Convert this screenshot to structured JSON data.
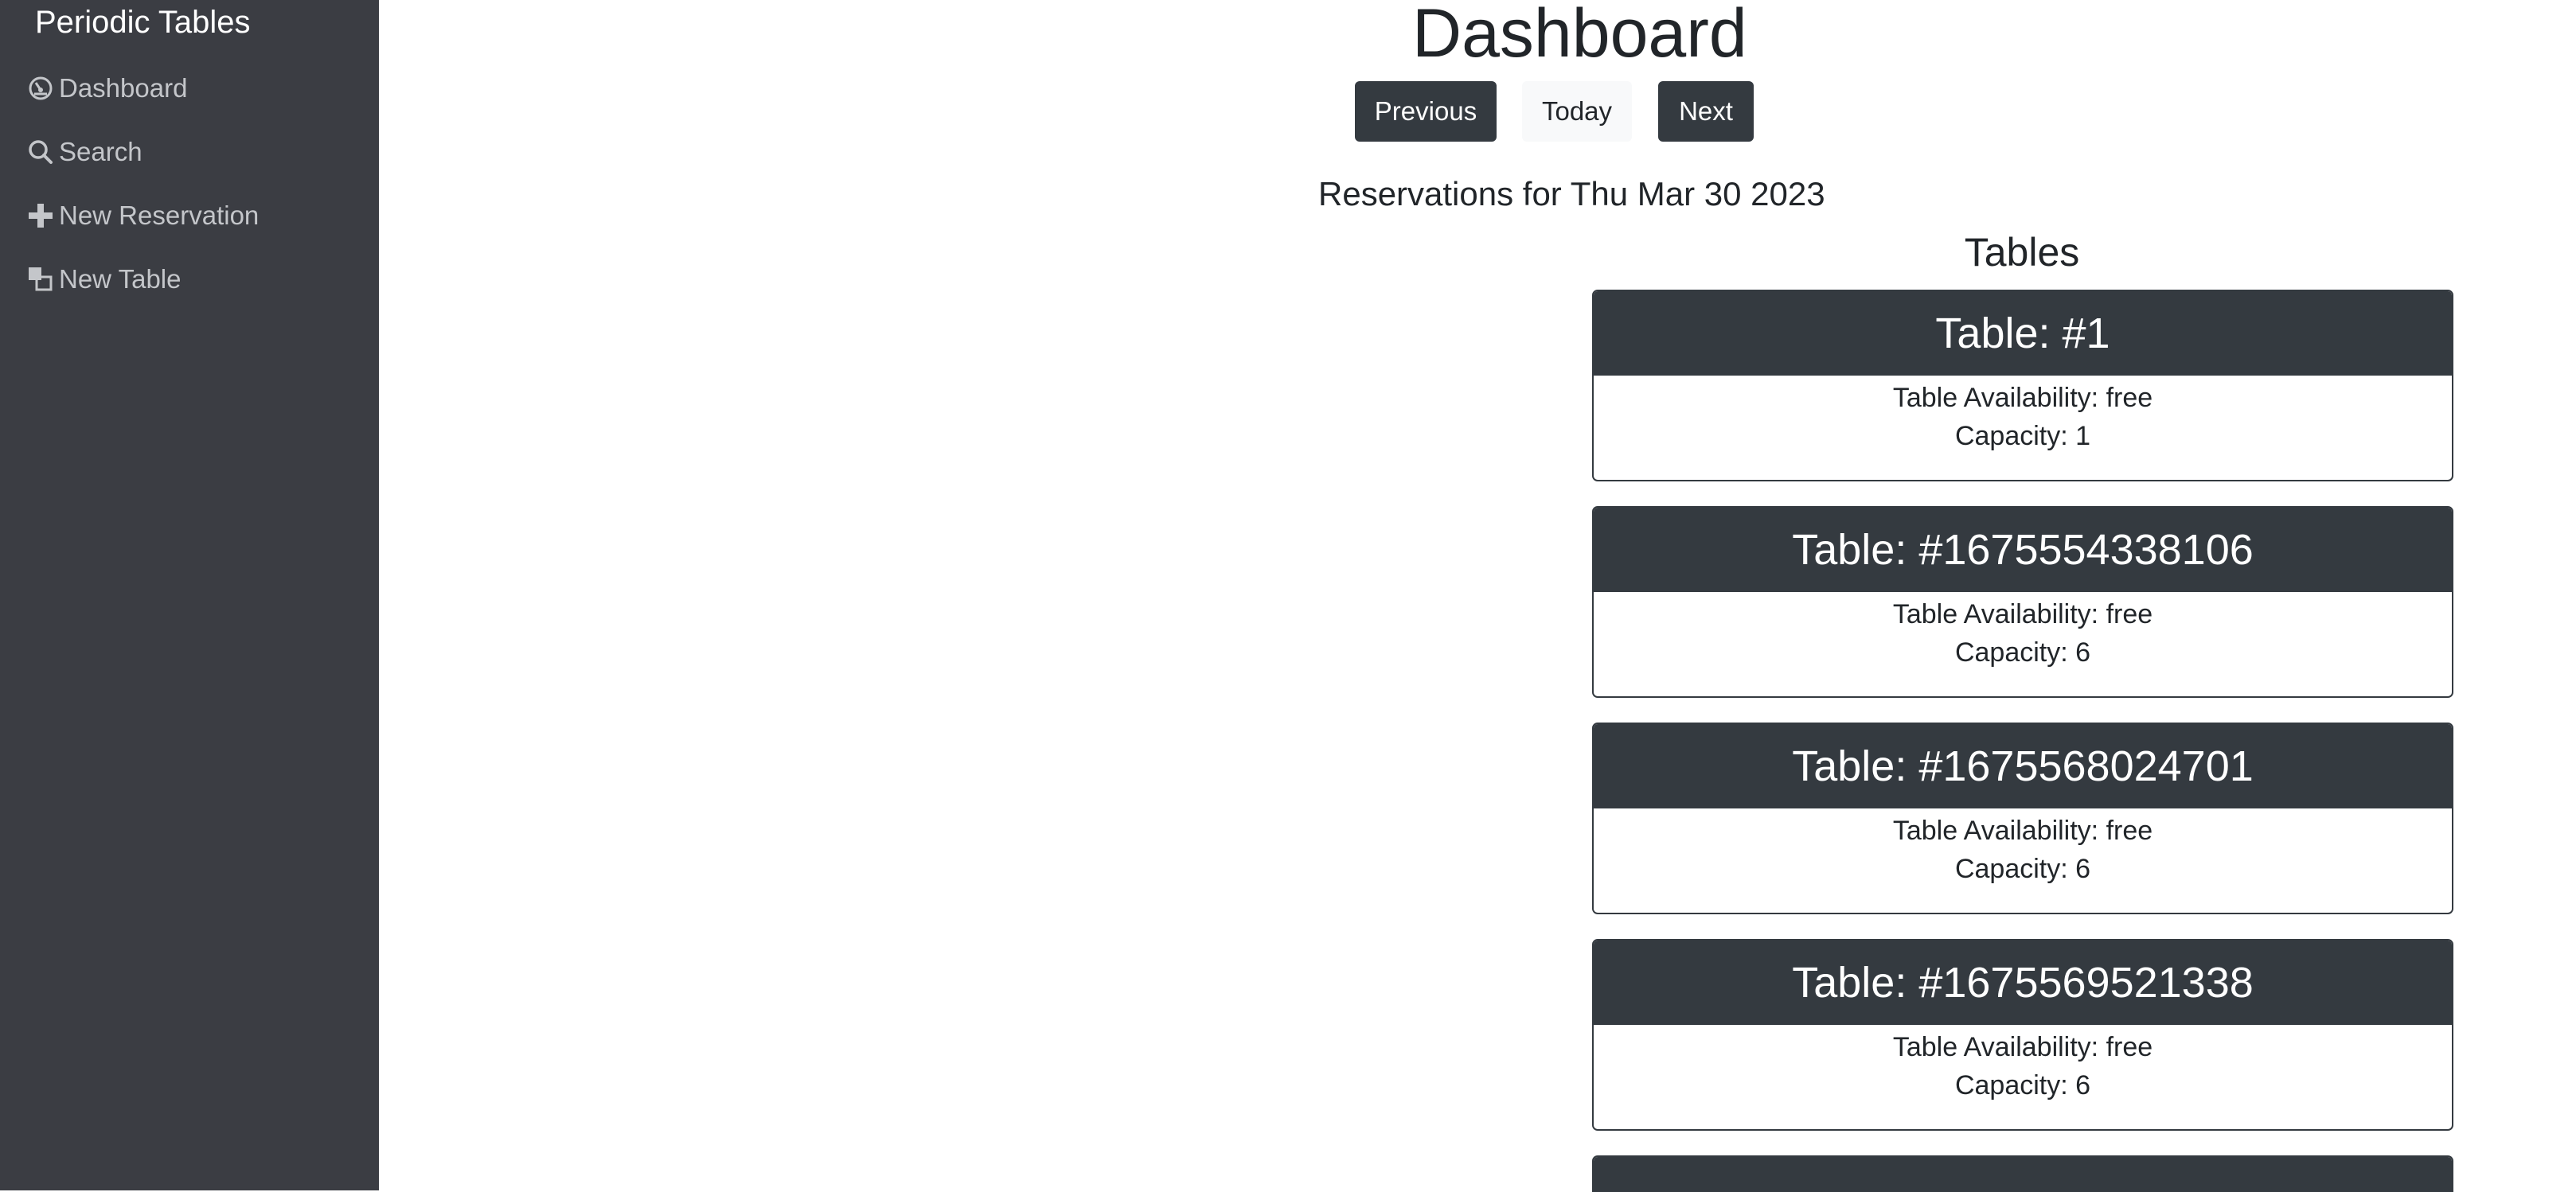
{
  "sidebar": {
    "brand": "Periodic Tables",
    "items": [
      {
        "label": "Dashboard",
        "icon": "dashboard-icon"
      },
      {
        "label": "Search",
        "icon": "search-icon"
      },
      {
        "label": "New Reservation",
        "icon": "plus-icon"
      },
      {
        "label": "New Table",
        "icon": "layers-icon"
      }
    ]
  },
  "main": {
    "title": "Dashboard",
    "buttons": {
      "previous": "Previous",
      "today": "Today",
      "next": "Next"
    },
    "reservations_heading": "Reservations for Thu Mar 30 2023",
    "tables_heading": "Tables",
    "tables": [
      {
        "title": "Table: #1",
        "availability": "Table Availability: free",
        "capacity": "Capacity: 1"
      },
      {
        "title": "Table: #1675554338106",
        "availability": "Table Availability: free",
        "capacity": "Capacity: 6"
      },
      {
        "title": "Table: #1675568024701",
        "availability": "Table Availability: free",
        "capacity": "Capacity: 6"
      },
      {
        "title": "Table: #1675569521338",
        "availability": "Table Availability: free",
        "capacity": "Capacity: 6"
      }
    ]
  },
  "colors": {
    "sidebar_bg": "#3b3d43",
    "dark": "#343a40",
    "nav_text": "#c4c6ca"
  }
}
